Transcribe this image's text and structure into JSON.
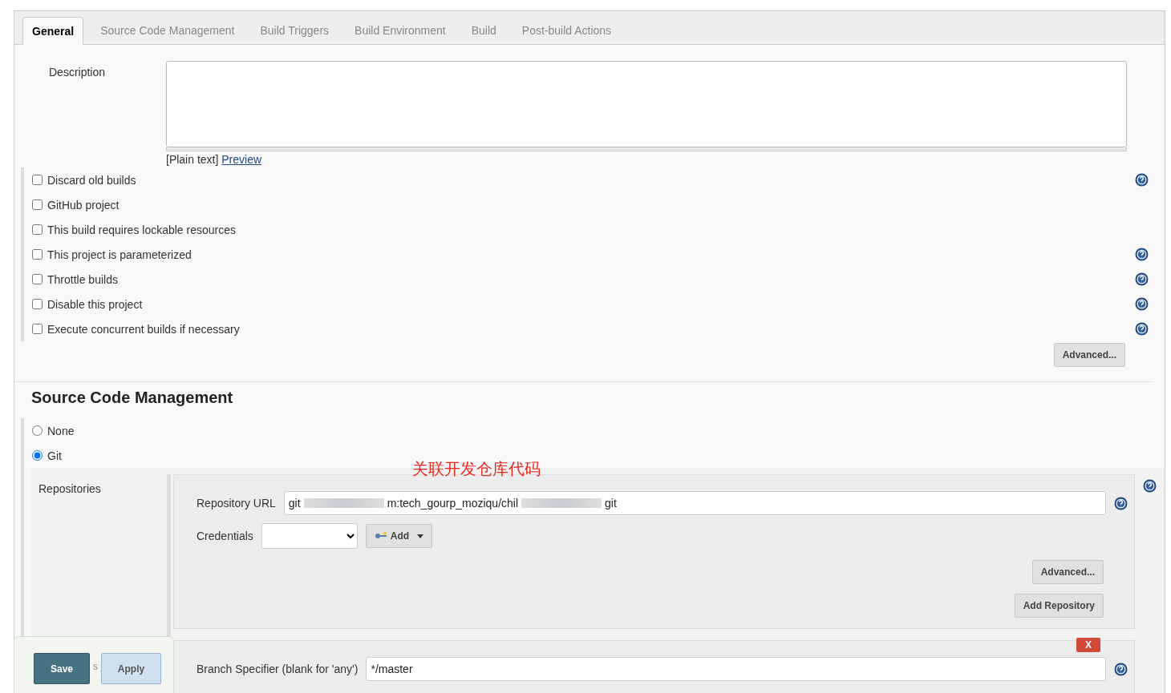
{
  "tabs": [
    {
      "label": "General",
      "selected": true
    },
    {
      "label": "Source Code Management",
      "selected": false
    },
    {
      "label": "Build Triggers",
      "selected": false
    },
    {
      "label": "Build Environment",
      "selected": false
    },
    {
      "label": "Build",
      "selected": false
    },
    {
      "label": "Post-build Actions",
      "selected": false
    }
  ],
  "description": {
    "label": "Description",
    "format_note": "[Plain text]",
    "preview_link": "Preview"
  },
  "options": [
    {
      "label": "Discard old builds",
      "checked": false,
      "help": true
    },
    {
      "label": "GitHub project",
      "checked": false,
      "help": false
    },
    {
      "label": "This build requires lockable resources",
      "checked": false,
      "help": false
    },
    {
      "label": "This project is parameterized",
      "checked": false,
      "help": true
    },
    {
      "label": "Throttle builds",
      "checked": false,
      "help": true
    },
    {
      "label": "Disable this project",
      "checked": false,
      "help": true
    },
    {
      "label": "Execute concurrent builds if necessary",
      "checked": false,
      "help": true
    }
  ],
  "general_advanced_button": "Advanced...",
  "scm": {
    "title": "Source Code Management",
    "choices": [
      {
        "label": "None",
        "selected": false
      },
      {
        "label": "Git",
        "selected": true
      }
    ],
    "annotation": "关联开发仓库代码",
    "repositories_label": "Repositories",
    "repository_url": {
      "label": "Repository URL",
      "value_parts": [
        "git",
        "m:tech_gourp_moziqu/chil",
        "git"
      ]
    },
    "credentials": {
      "label": "Credentials",
      "add_button": "Add"
    },
    "advanced_button": "Advanced...",
    "add_repository_button": "Add Repository",
    "branch": {
      "delete_button": "X",
      "label": "Branch Specifier (blank for 'any')",
      "value": "*/master"
    }
  },
  "bottom_bar": {
    "save_button": "Save",
    "apply_button": "Apply",
    "hidden_letter": "s"
  }
}
